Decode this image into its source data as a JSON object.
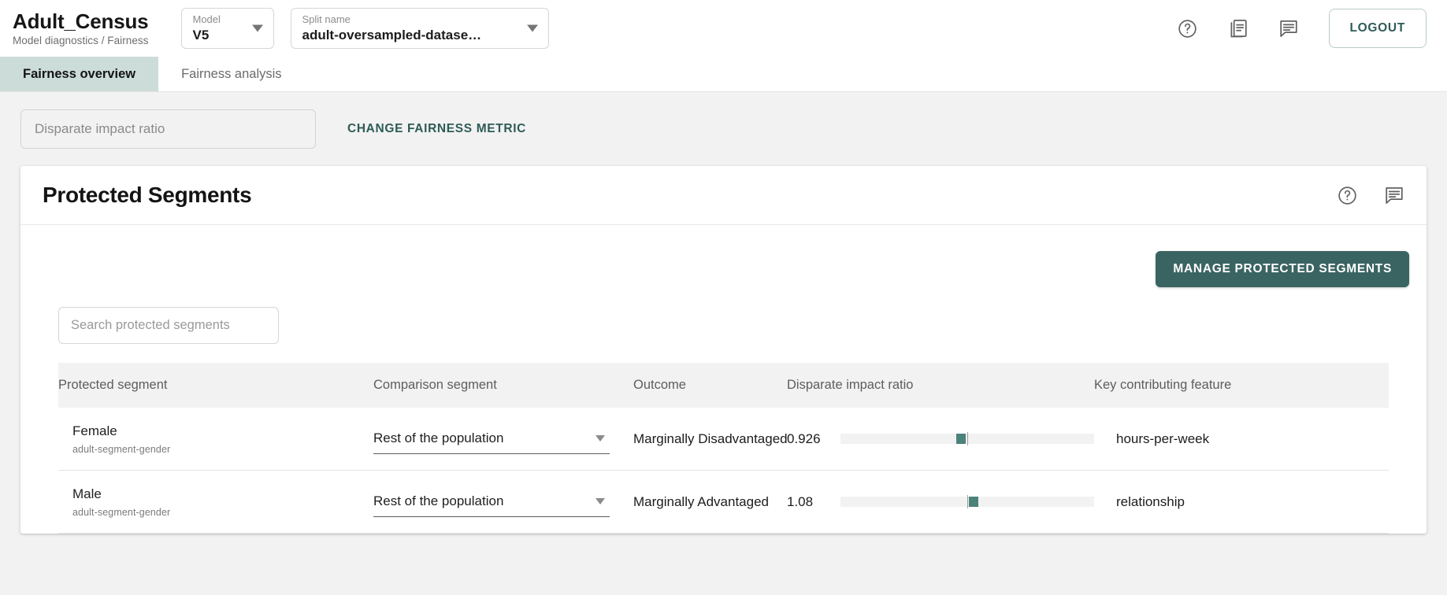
{
  "header": {
    "app_title": "Adult_Census",
    "breadcrumb": "Model diagnostics / Fairness",
    "model_selector": {
      "label": "Model",
      "value": "V5"
    },
    "split_selector": {
      "label": "Split name",
      "value": "adult-oversampled-datase…"
    },
    "help_icon": "help-circle-icon",
    "docs_icon": "documents-icon",
    "feedback_icon": "comment-icon",
    "logout_label": "LOGOUT"
  },
  "tabs": [
    {
      "label": "Fairness overview",
      "active": true
    },
    {
      "label": "Fairness analysis",
      "active": false
    }
  ],
  "metric_bar": {
    "selected_metric": "Disparate impact ratio",
    "change_metric_label": "CHANGE FAIRNESS METRIC"
  },
  "card": {
    "title": "Protected Segments",
    "help_icon": "help-circle-icon",
    "feedback_icon": "comment-icon",
    "manage_button_label": "MANAGE PROTECTED SEGMENTS",
    "search_placeholder": "Search protected segments",
    "search_value": ""
  },
  "table": {
    "columns": [
      "Protected segment",
      "Comparison segment",
      "Outcome",
      "Disparate impact ratio",
      "Key contributing feature"
    ],
    "rows": [
      {
        "segment_name": "Female",
        "segment_sub": "adult-segment-gender",
        "comparison": "Rest of the population",
        "outcome": "Marginally Disadvantaged",
        "ratio": "0.926",
        "gauge_percent": 45.5,
        "key_feature": "hours-per-week"
      },
      {
        "segment_name": "Male",
        "segment_sub": "adult-segment-gender",
        "comparison": "Rest of the population",
        "outcome": "Marginally Advantaged",
        "ratio": "1.08",
        "gauge_percent": 50.5,
        "key_feature": "relationship"
      }
    ]
  },
  "colors": {
    "accent_teal": "#3a6461",
    "gauge_marker": "#4b8279",
    "active_tab_bg": "#ccdcd9",
    "page_bg": "#f2f2f2"
  }
}
